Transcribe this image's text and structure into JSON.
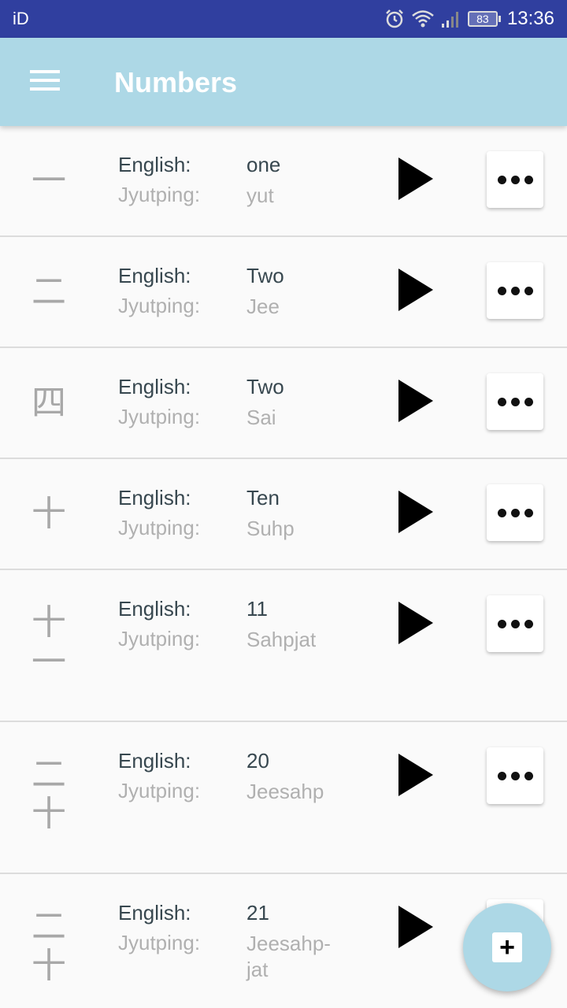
{
  "status_bar": {
    "carrier": "iD",
    "battery": "83",
    "time": "13:36"
  },
  "app_bar": {
    "title": "Numbers"
  },
  "labels": {
    "english": "English:",
    "jyutping": "Jyutping:"
  },
  "rows": [
    {
      "chars": [
        "一"
      ],
      "english": "one",
      "jyutping": "yut"
    },
    {
      "chars": [
        "二"
      ],
      "english": "Two",
      "jyutping": "Jee"
    },
    {
      "chars": [
        "四"
      ],
      "english": "Two",
      "jyutping": "Sai"
    },
    {
      "chars": [
        "十"
      ],
      "english": "Ten",
      "jyutping": "Suhp"
    },
    {
      "chars": [
        "十",
        "一"
      ],
      "english": "11",
      "jyutping": "Sahpjat"
    },
    {
      "chars": [
        "二",
        "十"
      ],
      "english": "20",
      "jyutping": "Jeesahp"
    },
    {
      "chars": [
        "二",
        "十"
      ],
      "english": "21",
      "jyutping": "Jeesahp-jat"
    }
  ],
  "icons": {
    "menu": "hamburger-menu-icon",
    "play": "play-icon",
    "more": "more-dots-icon",
    "add": "plus-icon"
  },
  "colors": {
    "status_bar": "#303f9f",
    "app_bar": "#add8e6",
    "fab": "#add8e6"
  }
}
